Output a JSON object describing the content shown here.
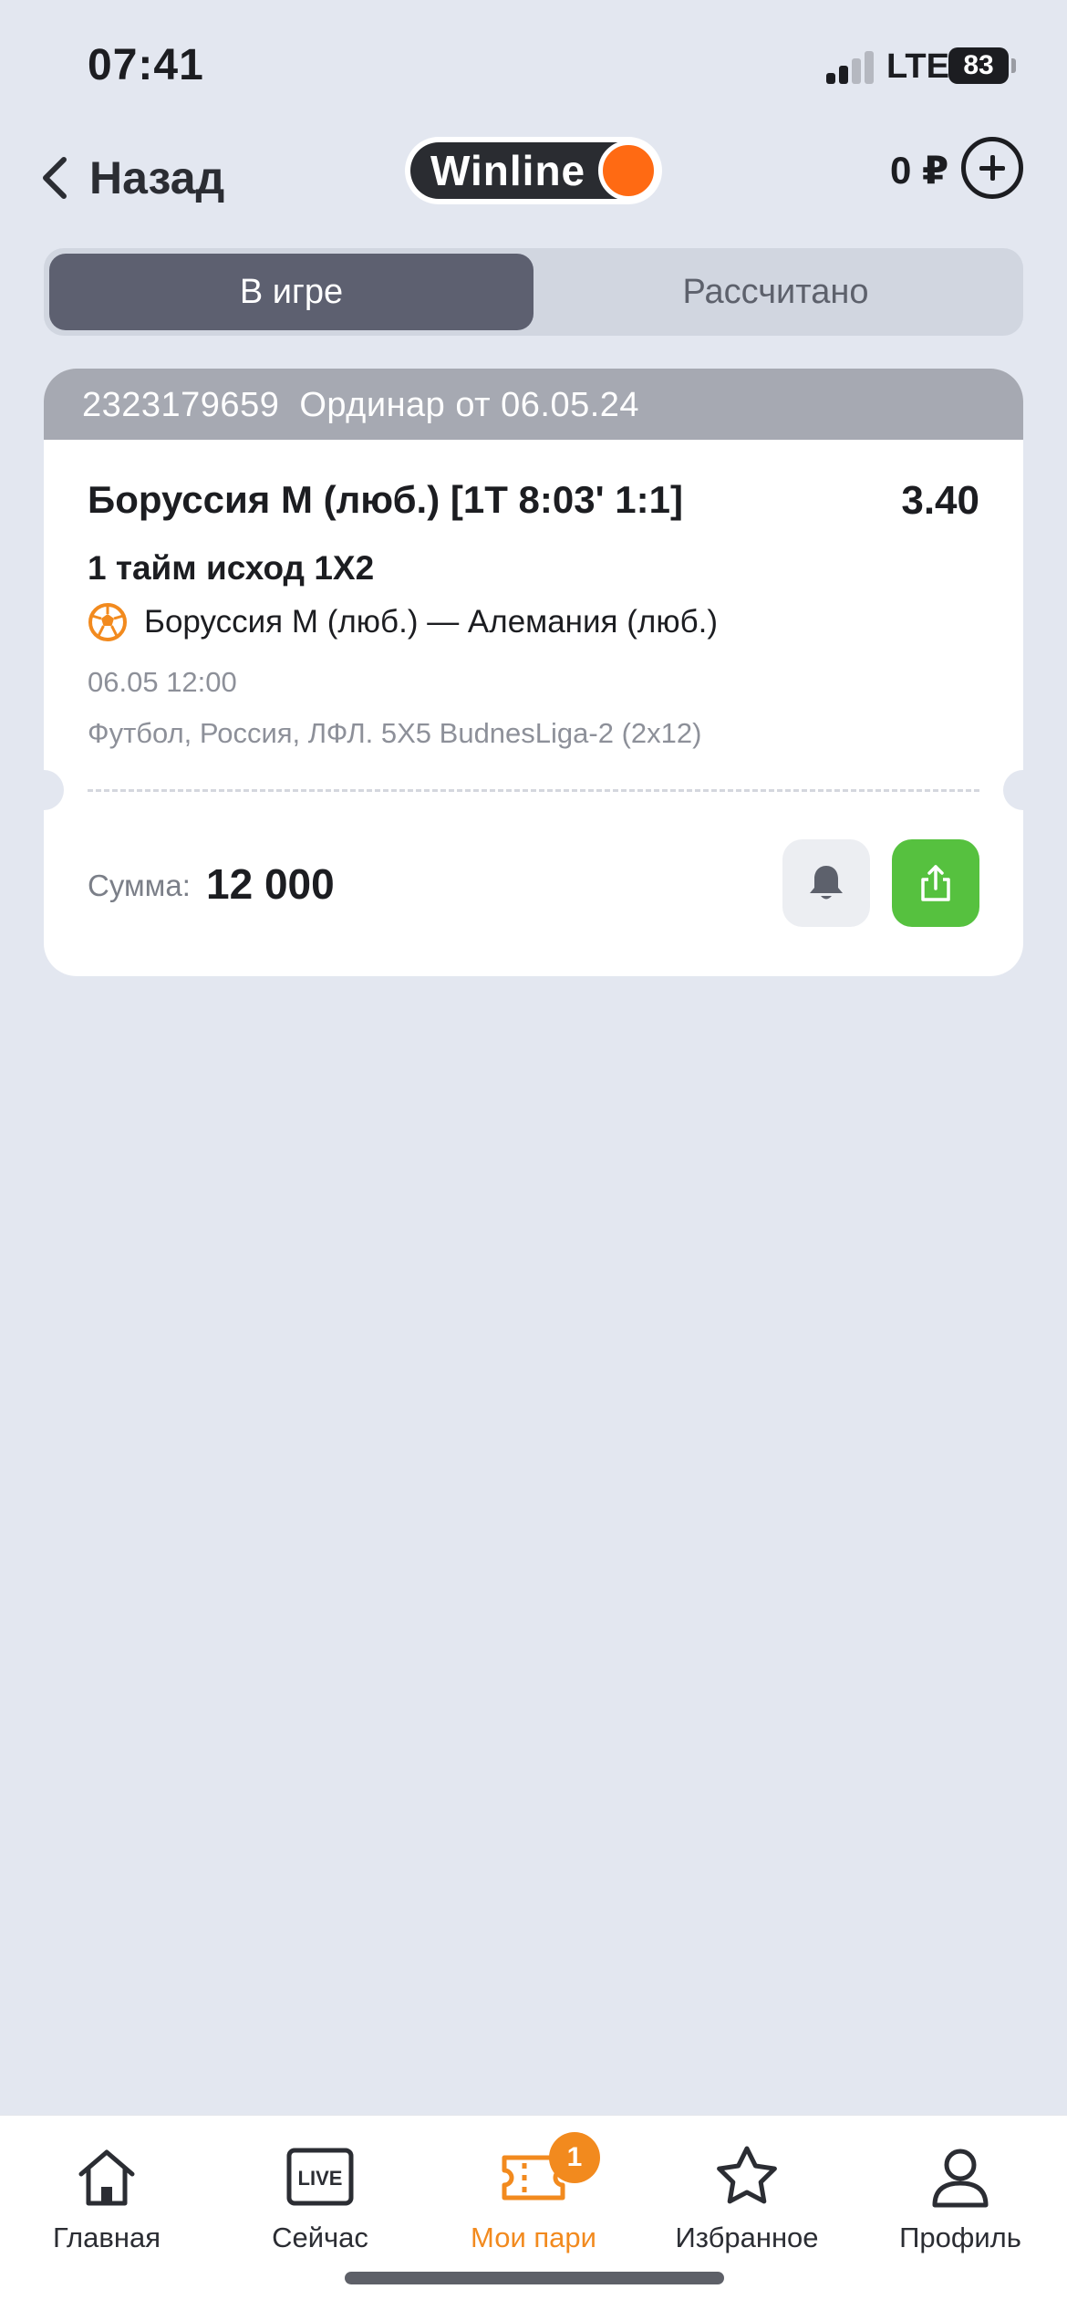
{
  "status_bar": {
    "time": "07:41",
    "network": "LTE",
    "battery": "83"
  },
  "header": {
    "back_label": "Назад",
    "logo_text": "Winline",
    "balance": "0 ₽"
  },
  "tabs": [
    {
      "label": "В игре",
      "active": true
    },
    {
      "label": "Рассчитано",
      "active": false
    }
  ],
  "bet": {
    "id": "2323179659",
    "type": "Ординар от 06.05.24",
    "event": "Боруссия М (люб.) [1Т 8:03' 1:1]",
    "odds": "3.40",
    "market": "1 тайм исход 1Х2",
    "match": "Боруссия М (люб.) — Алемания (люб.)",
    "datetime": "06.05 12:00",
    "league": "Футбол, Россия, ЛФЛ. 5X5 BudnesLiga-2 (2x12)",
    "sum_label": "Сумма:",
    "sum_value": "12 000"
  },
  "bottom_nav": [
    {
      "label": "Главная",
      "icon": "home-icon"
    },
    {
      "label": "Сейчас",
      "icon": "live-icon",
      "icon_text": "LIVE"
    },
    {
      "label": "Мои пари",
      "icon": "ticket-icon",
      "active": true,
      "badge": "1"
    },
    {
      "label": "Избранное",
      "icon": "star-icon"
    },
    {
      "label": "Профиль",
      "icon": "user-icon"
    }
  ],
  "colors": {
    "accent": "#f28a1e",
    "logo_dot": "#ff6a13",
    "share_green": "#56c13f",
    "tab_active": "#5d6070"
  }
}
